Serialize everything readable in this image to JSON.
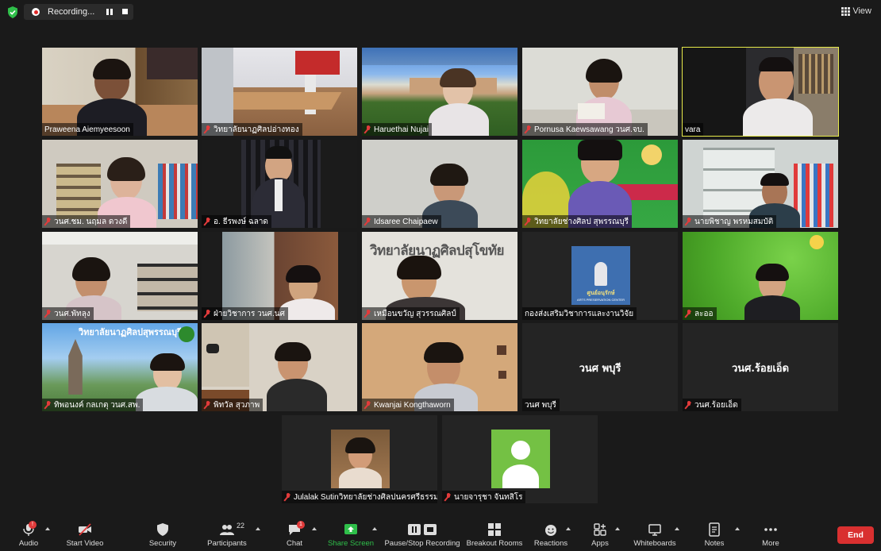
{
  "topbar": {
    "recording_label": "Recording...",
    "view_label": "View"
  },
  "participants": [
    {
      "name": "Praweena Aiemyeesoon",
      "muted": false
    },
    {
      "name": "วิทยาลัยนาฏศิลปอ่างทอง",
      "muted": true
    },
    {
      "name": "Haruethai Nujai",
      "muted": true
    },
    {
      "name": "Pornusa Kaewsawang วนศ.จบ.",
      "muted": true
    },
    {
      "name": "vara",
      "muted": false,
      "speaking": true
    },
    {
      "name": "วนศ.ชม. นฤมล ดวงดี",
      "muted": true
    },
    {
      "name": "อ. ธีรพงษ์ ฉลาด",
      "muted": true
    },
    {
      "name": "Idsaree Chaipaew",
      "muted": true
    },
    {
      "name": "วิทยาลัยช่างศิลป สุพรรณบุรี",
      "muted": true
    },
    {
      "name": "นายพิชาญ พรหมสมบัติ",
      "muted": true
    },
    {
      "name": "วนศ.พัทลุง",
      "muted": true
    },
    {
      "name": "ฝ่ายวิชาการ วนศ.นศ",
      "muted": true
    },
    {
      "name": "เหมือนขวัญ สุวรรณศิลป์",
      "muted": true
    },
    {
      "name": "กองส่งเสริมวิชาการและงานวิจัย",
      "muted": false
    },
    {
      "name": "ละออ",
      "muted": true
    },
    {
      "name": "ทิพอนงค์ กลเกตุ วนศ.สพ.",
      "muted": true
    },
    {
      "name": "พิทวัล สุวภาพ",
      "muted": true
    },
    {
      "name": "Kwanjai Kongthaworn",
      "muted": true
    },
    {
      "name": "วนศ พบุรี",
      "muted": false,
      "display_text": "วนศ พบุรี"
    },
    {
      "name": "วนศ.ร้อยเอ็ด",
      "muted": true,
      "display_text": "วนศ.ร้อยเอ็ด"
    },
    {
      "name": "Julalak Sutinวิทยาลัยช่างศิลปนครศรีธรรมราช",
      "muted": true
    },
    {
      "name": "นายจารุชา จันทสิโร",
      "muted": true
    }
  ],
  "tile_text": {
    "college_banner_1": "วิทยาลัยนาฏศิลปสุโขทัย",
    "college_banner_2": "วิทยาลัยนาฏศิลปสุพรรณบุรี",
    "poster_title": "ศูนย์อนุรักษ์",
    "poster_sub": "ARTS PRESERVATION CENTER"
  },
  "toolbar": {
    "audio": "Audio",
    "video": "Start Video",
    "security": "Security",
    "participants": "Participants",
    "participants_count": "22",
    "chat": "Chat",
    "chat_badge": "1",
    "audio_badge": "!",
    "share": "Share Screen",
    "record": "Pause/Stop Recording",
    "breakout": "Breakout Rooms",
    "reactions": "Reactions",
    "apps": "Apps",
    "whiteboards": "Whiteboards",
    "notes": "Notes",
    "more": "More",
    "end": "End"
  },
  "colors": {
    "muted_red": "#e23b3b",
    "speaking_outline": "#e6e94a",
    "end_button": "#d93030",
    "share_green": "#2fbf4a"
  }
}
